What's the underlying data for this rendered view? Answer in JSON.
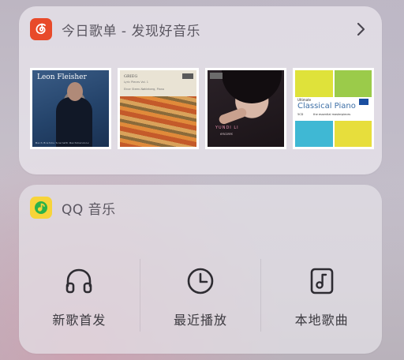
{
  "widgets": [
    {
      "title": "今日歌单 - 发现好音乐",
      "app_icon": "netease-cloud-music-icon",
      "accent": "#e84a2a",
      "covers": [
        {
          "name": "Leon Fleisher",
          "sub": "Bach  Brahms  Scarlatti  Rachmaninov"
        },
        {
          "line1": "GRIEG",
          "line2": "Lyric Pieces Vol. 1",
          "line3": "Einar Steen-Nøkleberg, Piano"
        },
        {
          "name": "YUNDI LI",
          "sub": "encores"
        },
        {
          "line1": "Ultimate",
          "line2": "Classical Piano",
          "line3": "5CD",
          "line4": "the essential masterpieces"
        }
      ]
    },
    {
      "title": "QQ 音乐",
      "app_icon": "qq-music-icon",
      "accent": "#f7d43a",
      "actions": [
        {
          "label": "新歌首发",
          "icon": "headphones-icon"
        },
        {
          "label": "最近播放",
          "icon": "clock-icon"
        },
        {
          "label": "本地歌曲",
          "icon": "music-note-icon"
        }
      ]
    }
  ]
}
